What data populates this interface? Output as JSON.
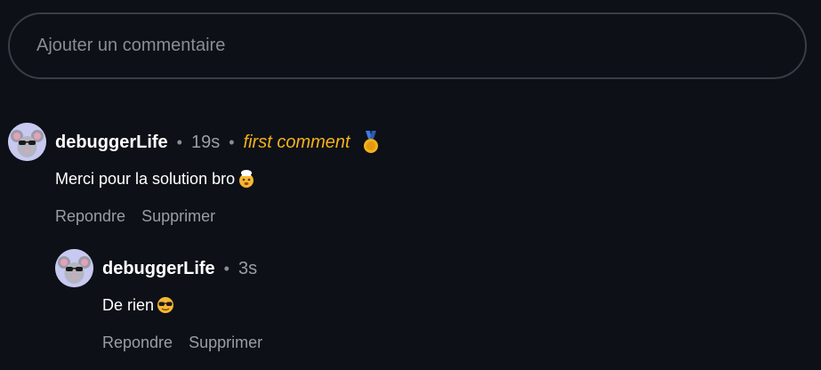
{
  "composer": {
    "placeholder": "Ajouter un commentaire"
  },
  "comments": [
    {
      "username": "debuggerLife",
      "time": "19s",
      "badge": "first comment",
      "badge_icon": "medal-icon",
      "text": "Merci pour la solution bro",
      "emoji": "chef-face-emoji",
      "actions": {
        "reply": "Repondre",
        "delete": "Supprimer"
      }
    },
    {
      "username": "debuggerLife",
      "time": "3s",
      "text": "De rien",
      "emoji": "sunglasses-face-emoji",
      "actions": {
        "reply": "Repondre",
        "delete": "Supprimer"
      }
    }
  ],
  "colors": {
    "background": "#0d1017",
    "badge": "#f2b21b",
    "muted": "#9a9da4",
    "border": "#3a3d45",
    "avatar_bg": "#c7c9f0"
  }
}
